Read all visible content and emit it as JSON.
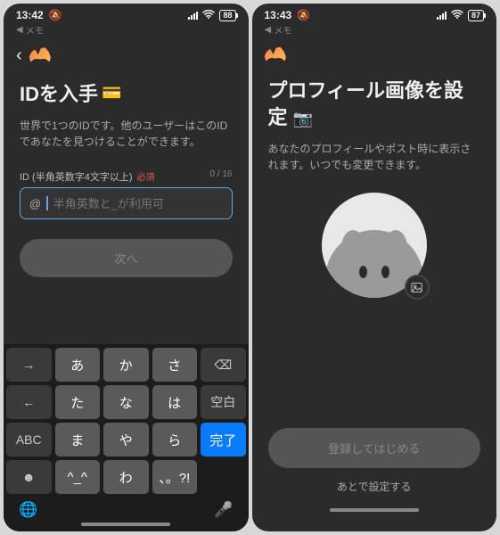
{
  "left": {
    "status": {
      "time": "13:42",
      "memo": "メモ",
      "battery": "88"
    },
    "title": "IDを入手",
    "title_emoji": "💳",
    "desc": "世界で1つのIDです。他のユーザーはこのIDであなたを見つけることができます。",
    "field": {
      "label": "ID (半角英数字4文字以上)",
      "required": "必須",
      "counter": "0 / 16",
      "at": "@",
      "placeholder": "半角英数と_が利用可"
    },
    "next": "次へ",
    "keyboard": {
      "r1": [
        "→",
        "あ",
        "か",
        "さ",
        "⌫"
      ],
      "r2": [
        "←",
        "た",
        "な",
        "は",
        "空白"
      ],
      "r3": [
        "ABC",
        "ま",
        "や",
        "ら",
        "完了"
      ],
      "r4": [
        "☻",
        "^_^",
        "わ",
        "、。?!",
        ""
      ],
      "globe": "🌐",
      "mic": "🎤"
    }
  },
  "right": {
    "status": {
      "time": "13:43",
      "memo": "メモ",
      "battery": "87"
    },
    "title_a": "プロフィール画像を設",
    "title_b": "定",
    "title_emoji": "📷",
    "desc": "あなたのプロフィールやポスト時に表示されます。いつでも変更できます。",
    "primary": "登録してはじめる",
    "later": "あとで設定する"
  }
}
